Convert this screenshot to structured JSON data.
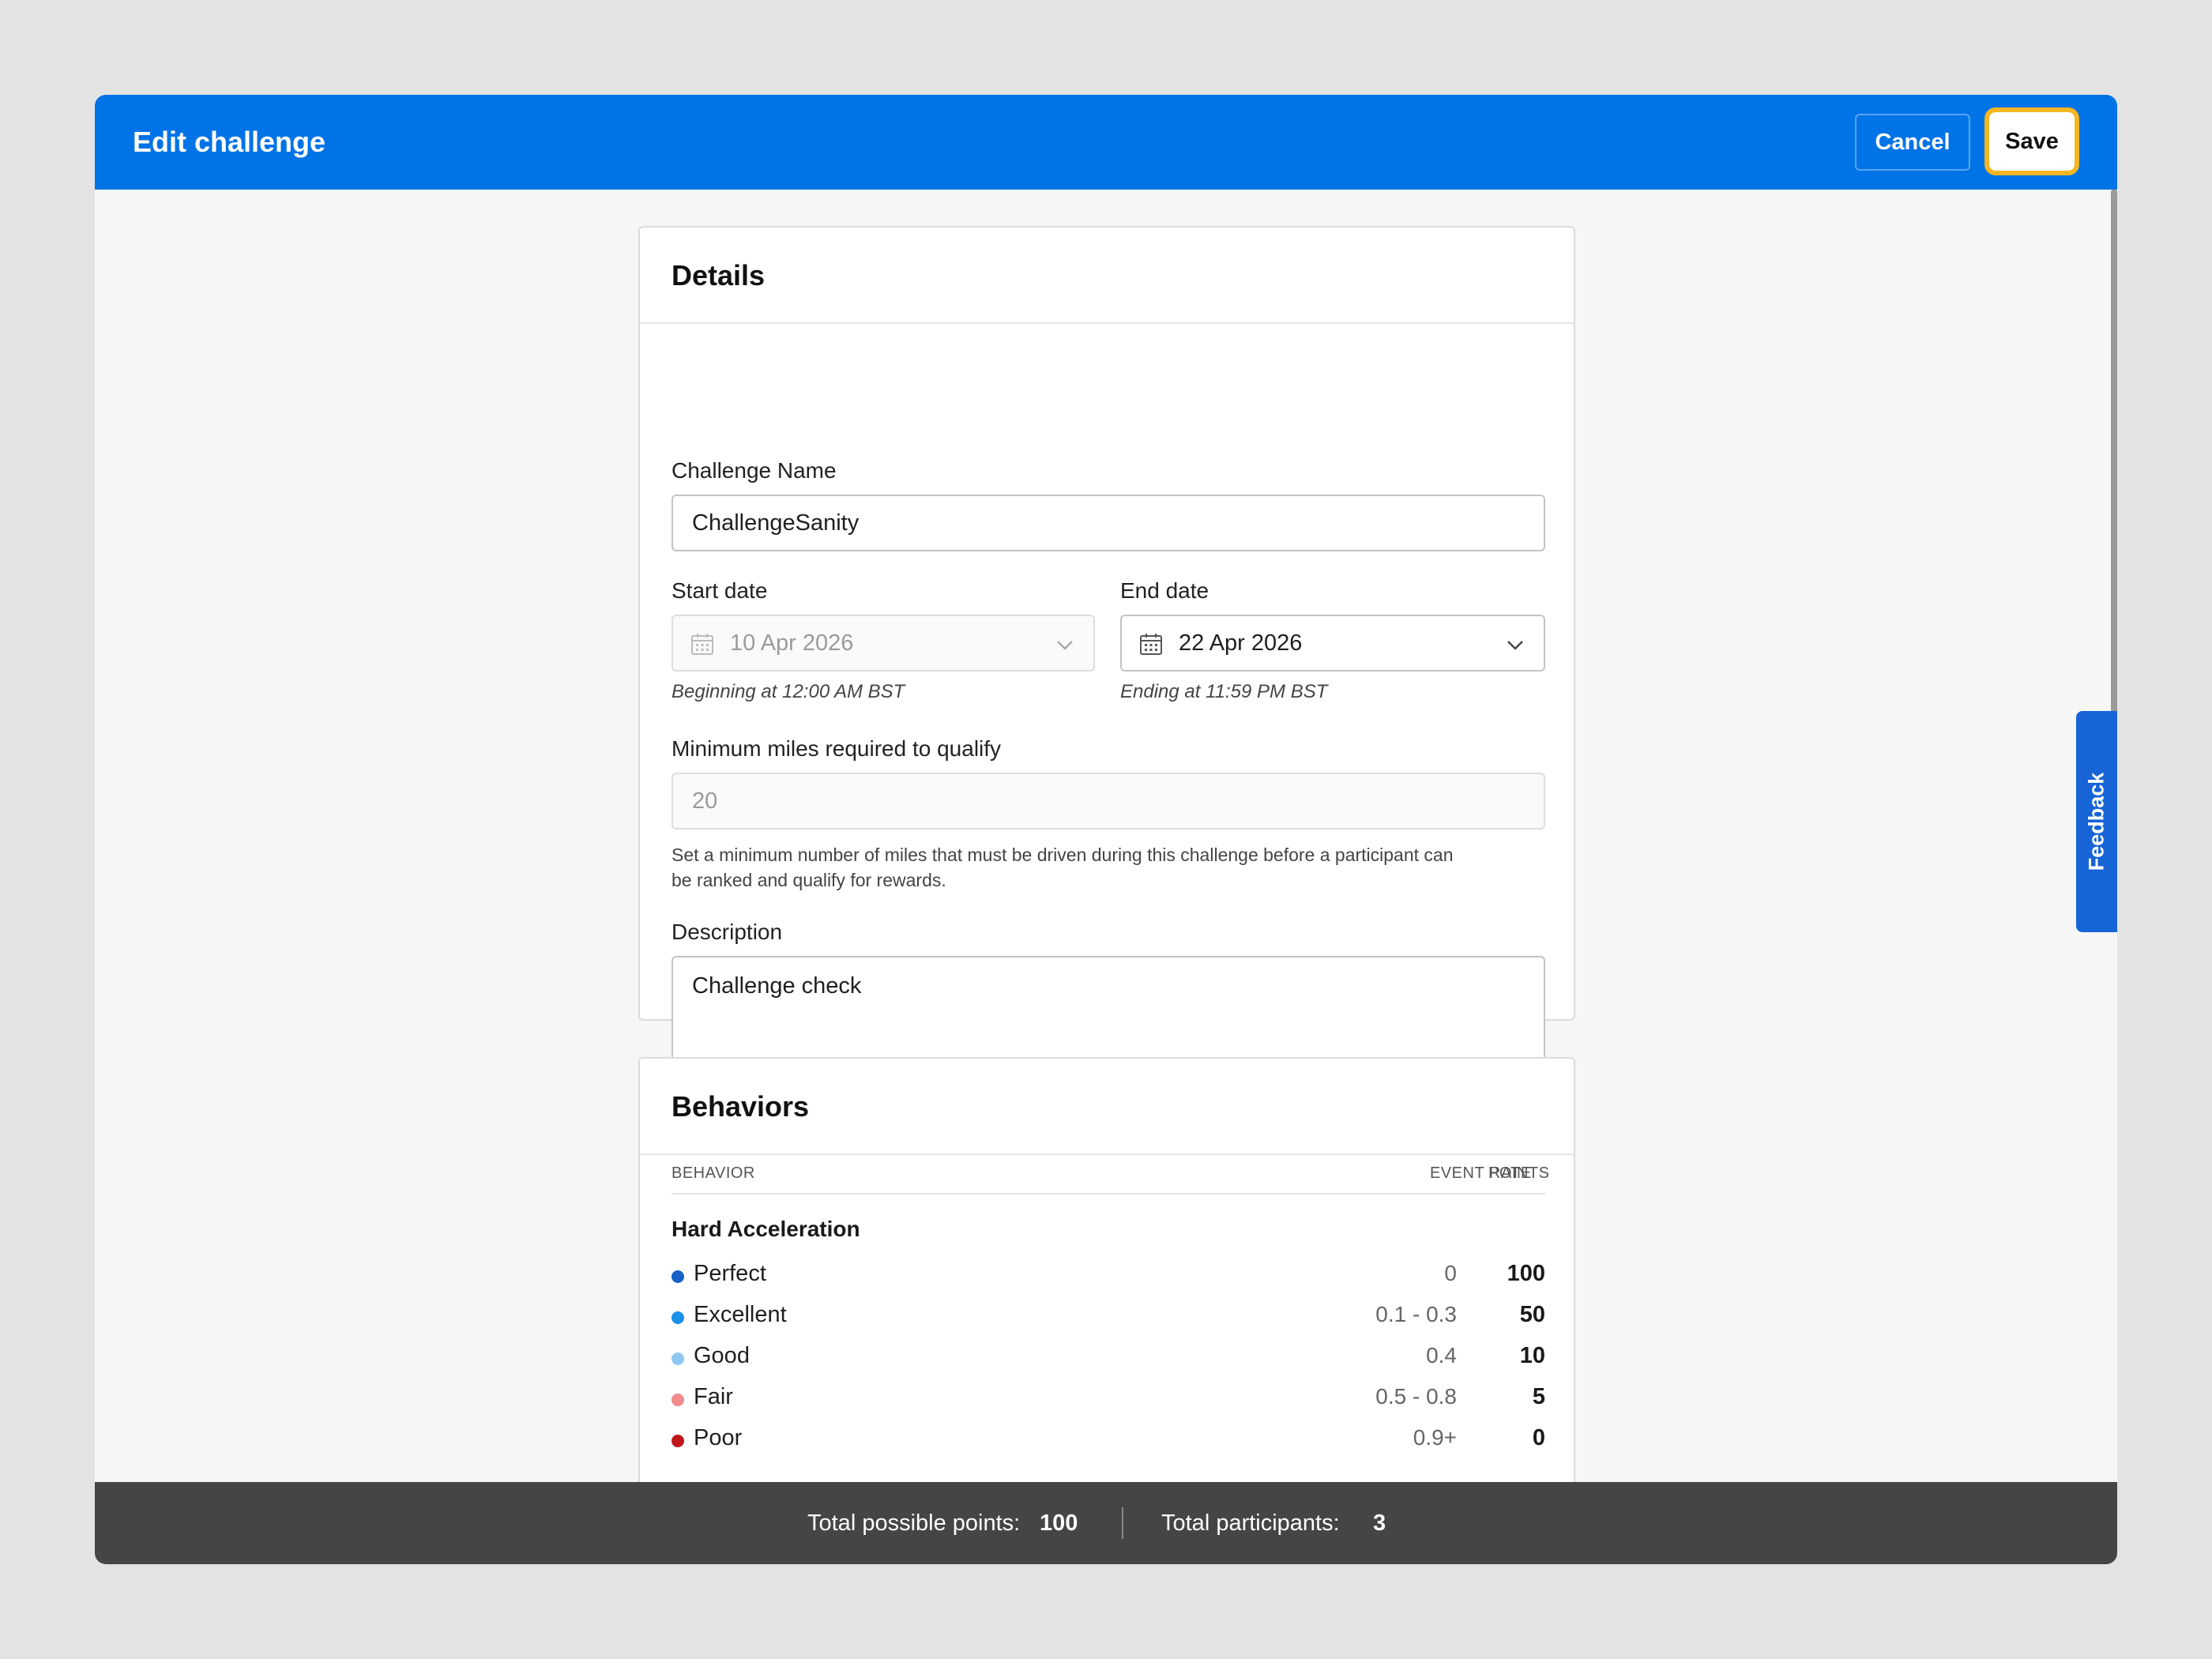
{
  "header": {
    "title": "Edit challenge",
    "cancel_label": "Cancel",
    "save_label": "Save",
    "color": "#0073e6"
  },
  "feedback_tab": {
    "label": "Feedback"
  },
  "details": {
    "title": "Details",
    "challenge_name": {
      "label": "Challenge Name",
      "value": "ChallengeSanity"
    },
    "start_date": {
      "label": "Start date",
      "value": "10 Apr 2026",
      "hint": "Beginning at 12:00 AM BST",
      "disabled": true
    },
    "end_date": {
      "label": "End date",
      "value": "22 Apr 2026",
      "hint": "Ending at 11:59 PM BST"
    },
    "min_miles": {
      "label": "Minimum miles required to qualify",
      "value": "20",
      "help_line1": "Set a minimum number of miles that must be driven during this challenge before a participant can",
      "help_line2": "be ranked and qualify for rewards."
    },
    "description": {
      "label": "Description",
      "value": "Challenge check"
    }
  },
  "behaviors": {
    "title": "Behaviors",
    "columns": {
      "behavior": "BEHAVIOR",
      "event_rate": "EVENT RATE",
      "points": "POINTS"
    },
    "groups": [
      {
        "name": "Hard Acceleration",
        "rows": [
          {
            "label": "Perfect",
            "rate": "0",
            "points": "100",
            "color": "#1660c8"
          },
          {
            "label": "Excellent",
            "rate": "0.1 - 0.3",
            "points": "50",
            "color": "#1a90e6"
          },
          {
            "label": "Good",
            "rate": "0.4",
            "points": "10",
            "color": "#8ec8f2"
          },
          {
            "label": "Fair",
            "rate": "0.5 - 0.8",
            "points": "5",
            "color": "#f28b8b"
          },
          {
            "label": "Poor",
            "rate": "0.9+",
            "points": "0",
            "color": "#c0161b"
          }
        ]
      }
    ]
  },
  "footer": {
    "total_points_label": "Total possible points:",
    "total_points_value": "100",
    "total_participants_label": "Total participants:",
    "total_participants_value": "3"
  }
}
